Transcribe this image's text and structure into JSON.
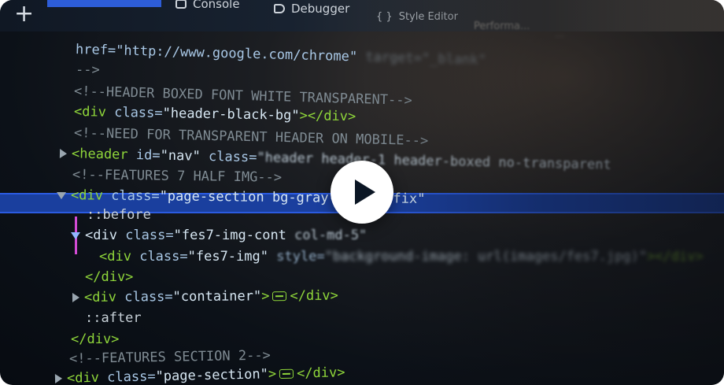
{
  "toolbar": {
    "plus": "+",
    "tabs": {
      "console": "Console",
      "debugger": "Debugger",
      "style_editor": "Style Editor",
      "performance": "Performa...",
      "more": "..."
    }
  },
  "code": {
    "l1_attr": "href=\"http://www.google.com/chrome\"",
    "l1_tail": "target=\"_blank\"",
    "l2": "-->",
    "l3": "<!--HEADER BOXED FONT WHITE TRANSPARENT-->",
    "l4_open": "<div",
    "l4_attr": "class=",
    "l4_val": "\"header-black-bg\"",
    "l4_close": "></div>",
    "l5": "<!--NEED FOR TRANSPARENT HEADER ON MOBILE-->",
    "l6_open": "<header",
    "l6_attr1": "id=",
    "l6_val1": "\"nav\"",
    "l6_attr2": "class=",
    "l6_val2": "\"header header-1 header-boxed no-transparent",
    "l7": "<!--FEATURES 7 HALF IMG-->",
    "l8_open": "<div",
    "l8_attr": "class=",
    "l8_val": "\"page-section bg-gray-… clearfix\"",
    "l9": "::before",
    "l10_open": "<div",
    "l10_attr": "class=",
    "l10_val": "\"fes7-img-cont",
    "l10_val2": "col-md-5\"",
    "l11_open": "<div",
    "l11_attr1": "class=",
    "l11_val1": "\"fes7-img\"",
    "l11_attr2": "style=",
    "l11_val2": "\"background-image: url(images/fes7.jpg)\"",
    "l11_close": "></div>",
    "l12": "</div>",
    "l13_open": "<div",
    "l13_attr": "class=",
    "l13_val": "\"container\"",
    "l13_gt": ">",
    "l13_close": "</div>",
    "l14": "::after",
    "l15": "</div>",
    "l16": "<!--FEATURES SECTION 2-->",
    "l17_open": "<div",
    "l17_attr": "class=",
    "l17_val": "\"page-section\"",
    "l17_gt": ">",
    "l17_close": "</div>"
  },
  "colors": {
    "tag": "#8fd63a",
    "comment": "#7f8b93",
    "selection": "#1a3f9e",
    "guide": "#d24bd4",
    "toolbar_accent": "#2d5dd8"
  },
  "icons": {
    "play": "play-icon",
    "plus": "plus-icon",
    "console": "console-icon",
    "debugger": "debugger-icon"
  }
}
